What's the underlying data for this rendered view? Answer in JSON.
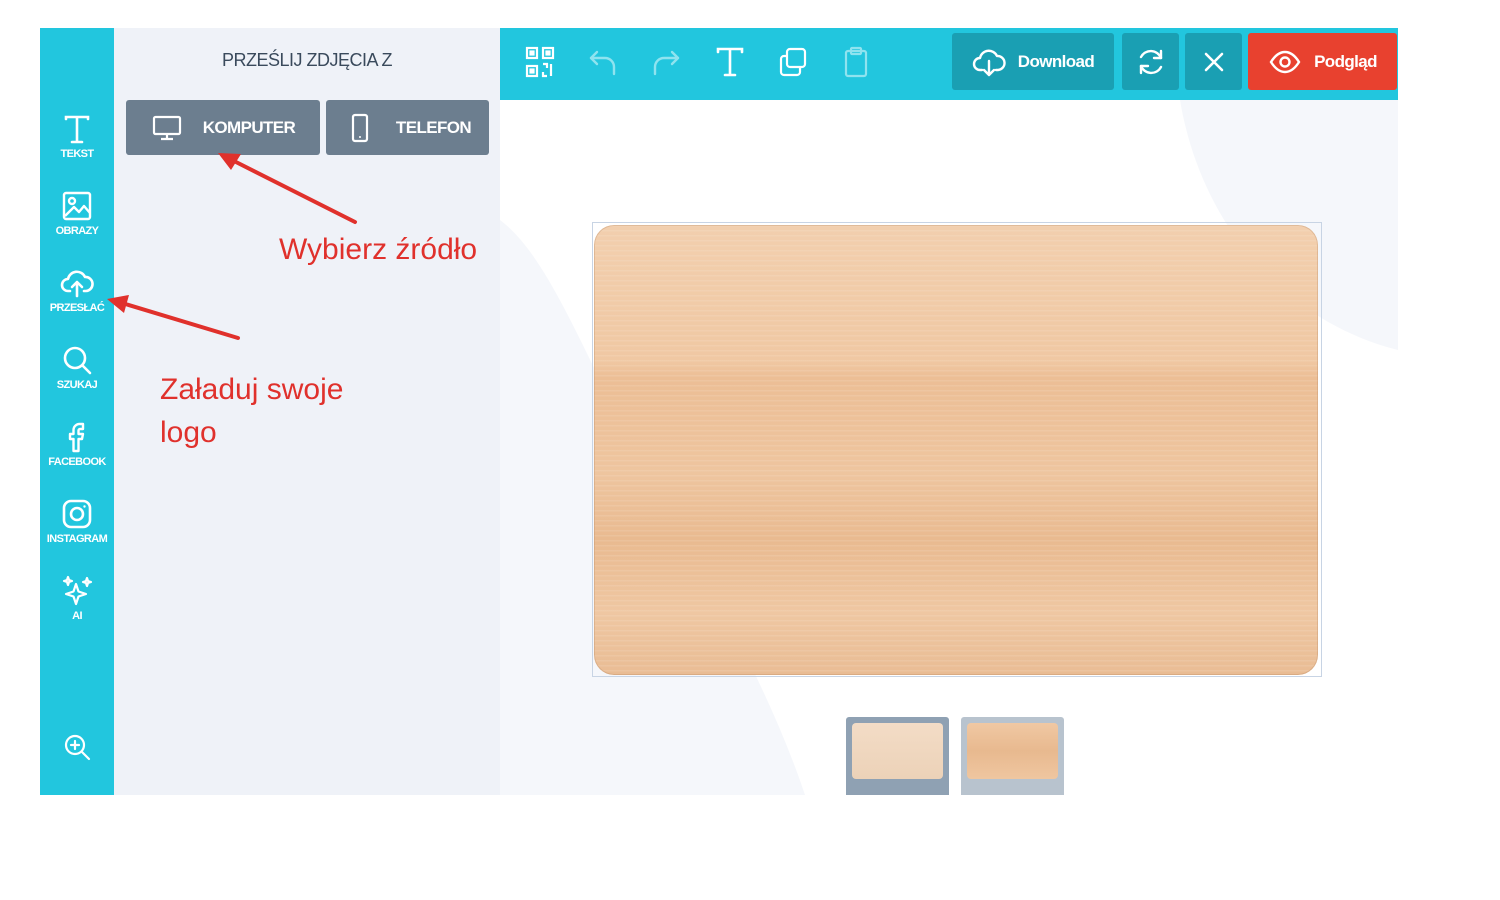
{
  "rail": {
    "items": [
      {
        "label": "TEKST",
        "icon": "text-icon"
      },
      {
        "label": "OBRAZY",
        "icon": "image-icon"
      },
      {
        "label": "PRZESŁAĆ",
        "icon": "cloud-upload-icon"
      },
      {
        "label": "SZUKAJ",
        "icon": "search-icon"
      },
      {
        "label": "FACEBOOK",
        "icon": "facebook-icon"
      },
      {
        "label": "INSTAGRAM",
        "icon": "instagram-icon"
      },
      {
        "label": "AI",
        "icon": "sparkles-icon"
      }
    ],
    "zoom_icon": "zoom-in-icon",
    "active": "PRZESŁAĆ"
  },
  "panel": {
    "title": "PRZEŚLIJ ZDJĘCIA Z",
    "buttons": [
      {
        "label": "KOMPUTER",
        "icon": "monitor-icon"
      },
      {
        "label": "TELEFON",
        "icon": "phone-icon"
      }
    ]
  },
  "toolbar": {
    "icons": [
      "qr-code-icon",
      "undo-icon",
      "redo-icon",
      "add-text-icon",
      "duplicate-icon",
      "clipboard-icon"
    ],
    "download_label": "Download",
    "preview_label": "Podgląd",
    "refresh_icon": "refresh-icon",
    "close_icon": "close-icon"
  },
  "thumbnails": [
    {
      "label": "",
      "selected": true
    },
    {
      "label": "",
      "selected": false
    }
  ],
  "annotations": {
    "choose_source": "Wybierz  źródło",
    "upload_logo_line1": "Załaduj swoje",
    "upload_logo_line2": "logo"
  },
  "colors": {
    "accent": "#22c6de",
    "button_gray": "#6c7e8f",
    "preview_red": "#e8412f",
    "annotation_red": "#e0312c"
  }
}
